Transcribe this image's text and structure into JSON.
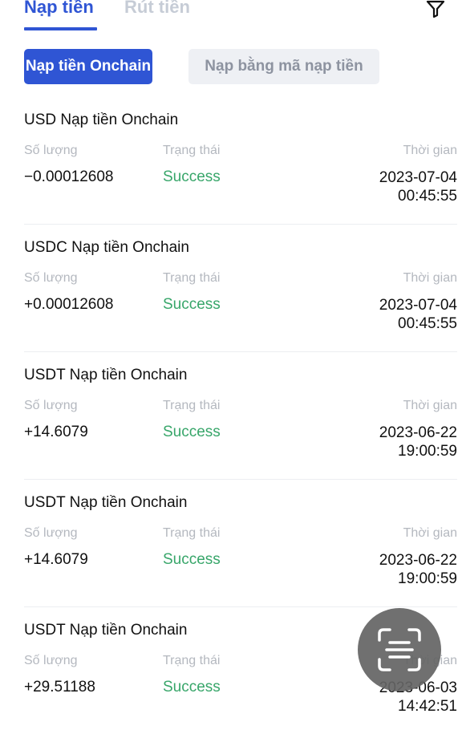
{
  "tabs": {
    "deposit": "Nạp tiền",
    "withdraw": "Rút tiền"
  },
  "subtabs": {
    "onchain": "Nạp tiền Onchain",
    "code": "Nạp bằng mã nạp tiền"
  },
  "labels": {
    "amount": "Số lượng",
    "status": "Trạng thái",
    "time": "Thời gian"
  },
  "records": [
    {
      "title": "USD Nạp tiền Onchain",
      "amount": "−0.00012608",
      "status": "Success",
      "date": "2023-07-04",
      "time": "00:45:55"
    },
    {
      "title": "USDC Nạp tiền Onchain",
      "amount": "+0.00012608",
      "status": "Success",
      "date": "2023-07-04",
      "time": "00:45:55"
    },
    {
      "title": "USDT Nạp tiền Onchain",
      "amount": "+14.6079",
      "status": "Success",
      "date": "2023-06-22",
      "time": "19:00:59"
    },
    {
      "title": "USDT Nạp tiền Onchain",
      "amount": "+14.6079",
      "status": "Success",
      "date": "2023-06-22",
      "time": "19:00:59"
    },
    {
      "title": "USDT Nạp tiền Onchain",
      "amount": "+29.51188",
      "status": "Success",
      "date": "2023-06-03",
      "time": "14:42:51"
    }
  ],
  "colors": {
    "accent": "#2f55d4",
    "success": "#38a66a",
    "muted": "#b4b8bf"
  },
  "icons": {
    "filter": "filter-icon",
    "scan": "scan-icon"
  }
}
